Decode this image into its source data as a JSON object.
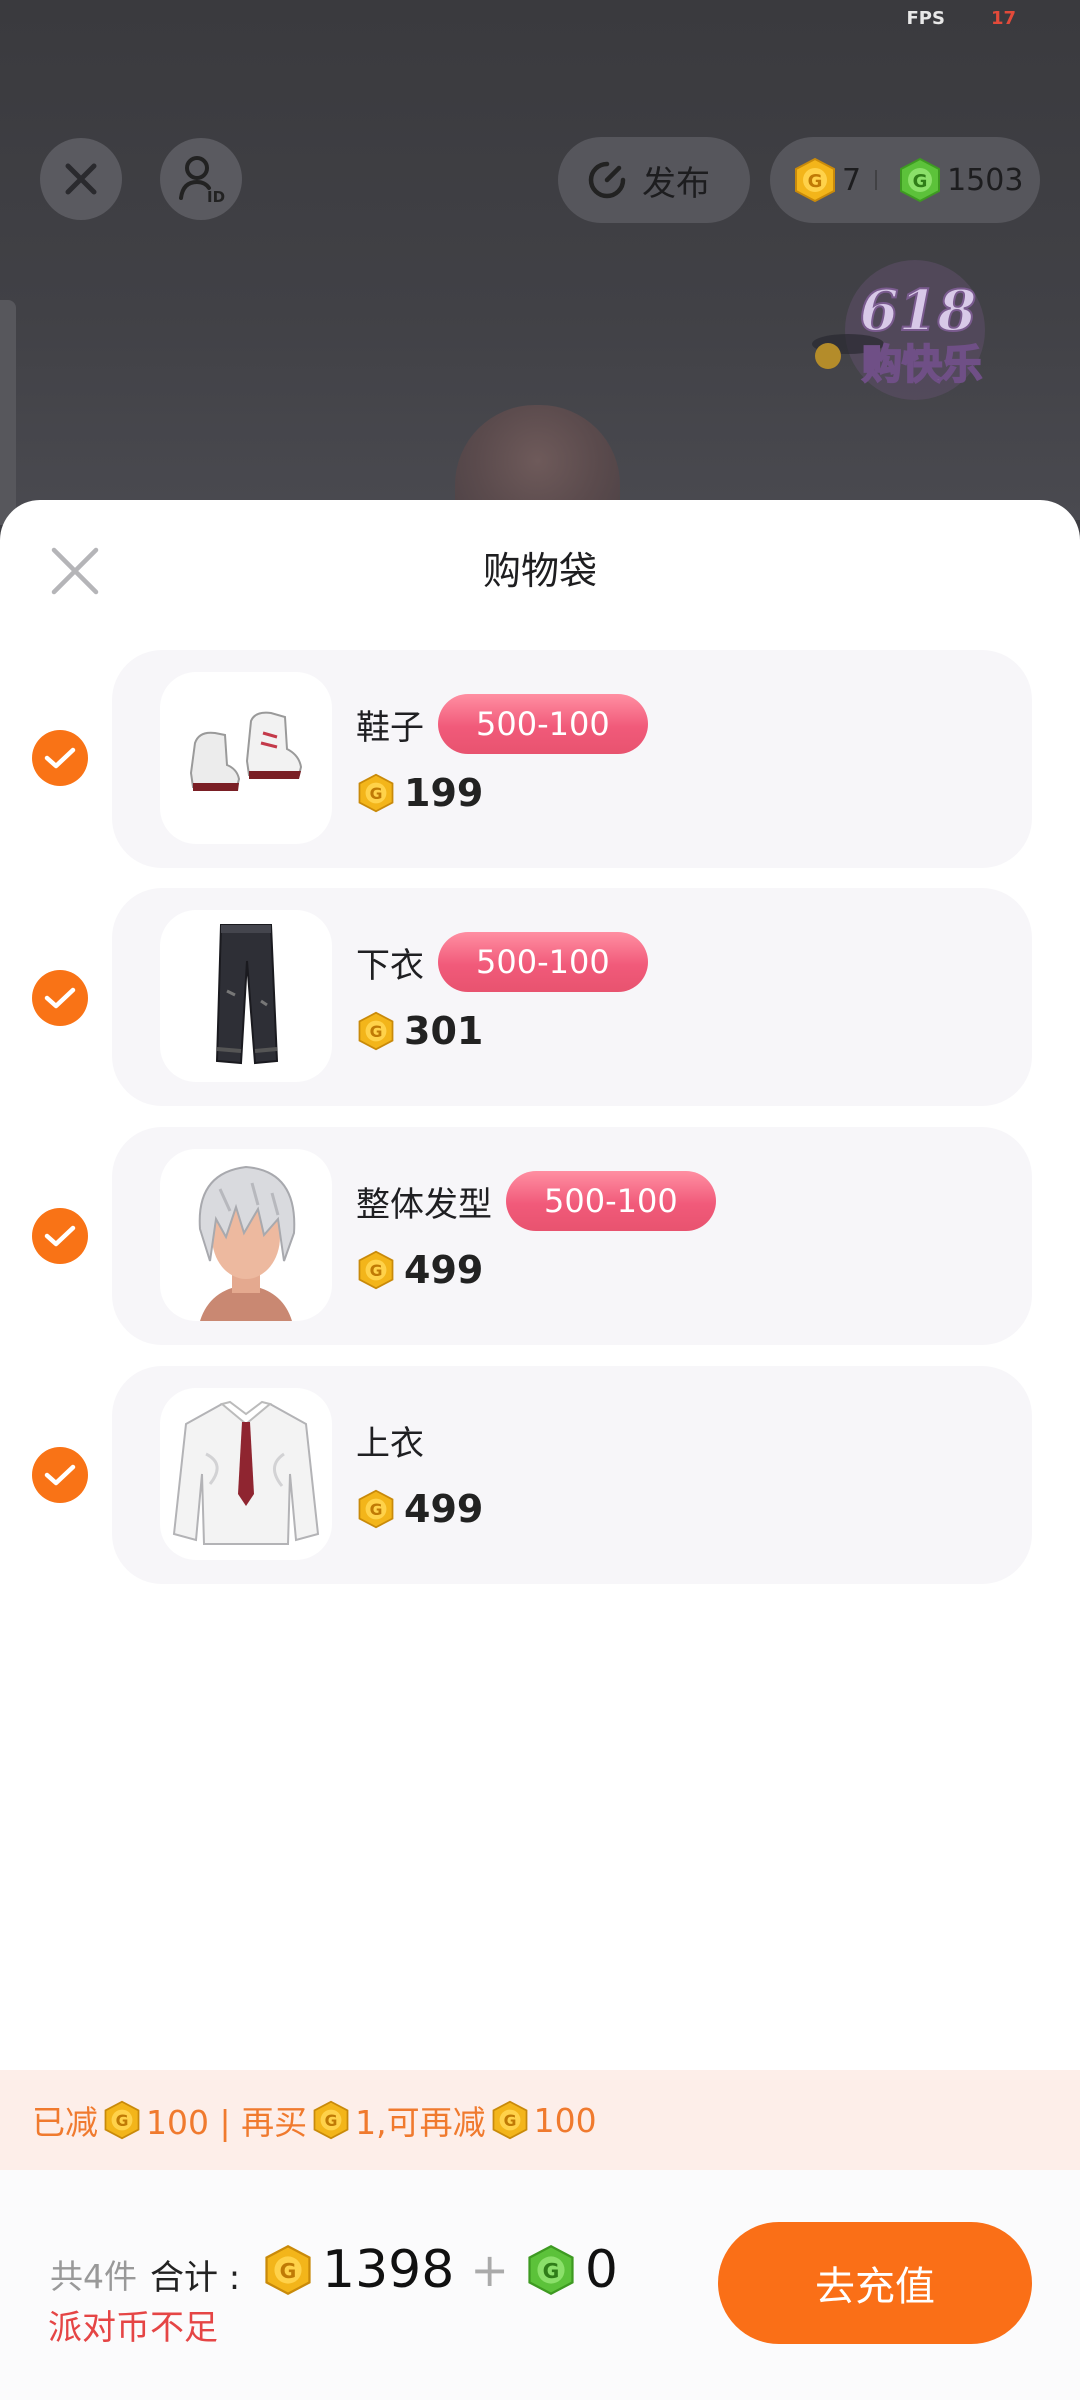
{
  "hud": {
    "fps_label": "FPS",
    "fps_value": "17"
  },
  "topbar": {
    "publish_label": "发布",
    "gold_count": "7",
    "green_count": "1503"
  },
  "promo": {
    "badge_number": "618",
    "badge_text": "购快乐"
  },
  "sheet": {
    "title": "购物袋",
    "items": [
      {
        "name": "鞋子",
        "tag": "500-100",
        "price": "199",
        "checked": true,
        "thumb": "sneakers"
      },
      {
        "name": "下衣",
        "tag": "500-100",
        "price": "301",
        "checked": true,
        "thumb": "pants"
      },
      {
        "name": "整体发型",
        "tag": "500-100",
        "price": "499",
        "checked": true,
        "thumb": "hair"
      },
      {
        "name": "上衣",
        "tag": "",
        "price": "499",
        "checked": true,
        "thumb": "shirt"
      }
    ]
  },
  "discount": {
    "reduced": "已减",
    "reduced_amount": "100 | 再买",
    "more_amount": "1,可再减",
    "next_amount": "100"
  },
  "footer": {
    "count_text": "共4件",
    "total_label": "合计 :",
    "total_gold": "1398",
    "plus": "+",
    "total_green": "0",
    "warning": "派对币不足",
    "recharge_label": "去充值"
  },
  "colors": {
    "accent": "#fa6f17",
    "tag": "#f15a7a",
    "gold": "#f3b51a",
    "green": "#5cc23a",
    "warn": "#e54545"
  }
}
